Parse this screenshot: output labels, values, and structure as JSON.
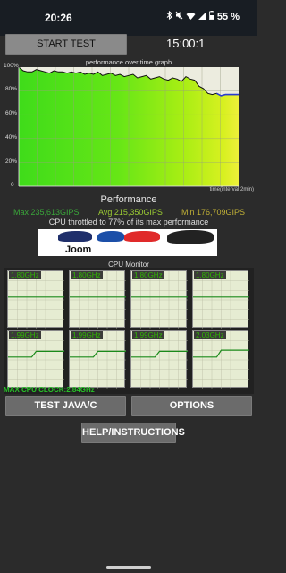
{
  "status_bar": {
    "time": "20:26",
    "battery": "55 %",
    "icons": [
      "bluetooth-icon",
      "mute-icon",
      "wifi-icon",
      "signal-icon",
      "battery-icon"
    ]
  },
  "controls": {
    "start_label": "START TEST",
    "timer": "15:00:1"
  },
  "graph": {
    "title": "performance over time graph",
    "y_labels": [
      "100%",
      "80%",
      "60%",
      "40%",
      "20%",
      "0"
    ],
    "x_note": "time(interval 2min)"
  },
  "chart_data": {
    "type": "line",
    "title": "performance over time graph",
    "xlabel": "time(interval 2min)",
    "ylabel": "",
    "ylim": [
      0,
      100
    ],
    "x": [
      0,
      1,
      2,
      3,
      4,
      5,
      6,
      7,
      8,
      9,
      10,
      11,
      12,
      13,
      14,
      15,
      16,
      17,
      18,
      19,
      20,
      21,
      22,
      23,
      24,
      25,
      26,
      27,
      28,
      29,
      30,
      31,
      32,
      33,
      34,
      35,
      36,
      37,
      38,
      39,
      40,
      41,
      42,
      43,
      44,
      45,
      46,
      47,
      48,
      49,
      50
    ],
    "values": [
      100,
      97,
      96,
      96,
      98,
      97,
      96,
      95,
      97,
      96,
      96,
      95,
      96,
      95,
      96,
      94,
      95,
      94,
      96,
      93,
      94,
      95,
      93,
      94,
      92,
      93,
      94,
      91,
      92,
      93,
      90,
      91,
      92,
      90,
      89,
      91,
      90,
      88,
      92,
      90,
      89,
      84,
      82,
      78,
      77,
      78,
      76,
      77,
      77,
      77,
      77
    ]
  },
  "performance": {
    "title": "Performance",
    "max": "Max 235,613GIPS",
    "avg": "Avg 215,350GIPS",
    "min": "Min 176,709GIPS",
    "throttle": "CPU throttled to 77% of its max performance",
    "colors": {
      "max": "#3aa63a",
      "avg": "#9ccc33",
      "min": "#c0b036"
    }
  },
  "ad": {
    "brand": "Joom"
  },
  "cpu": {
    "title": "CPU Monitor",
    "cores": [
      {
        "freq": "1.80GHz",
        "level": 0.55,
        "step": false
      },
      {
        "freq": "1.80GHz",
        "level": 0.55,
        "step": false
      },
      {
        "freq": "1.80GHz",
        "level": 0.55,
        "step": false
      },
      {
        "freq": "1.80GHz",
        "level": 0.55,
        "step": false
      },
      {
        "freq": "1.99GHz",
        "level": 0.65,
        "step": true
      },
      {
        "freq": "1.99GHz",
        "level": 0.65,
        "step": true
      },
      {
        "freq": "1.99GHz",
        "level": 0.65,
        "step": true
      },
      {
        "freq": "2.03GHz",
        "level": 0.67,
        "step": true
      }
    ],
    "max_clock": "MAX CPU CLOCK:2.84GHz"
  },
  "buttons": {
    "java": "TEST JAVA/C",
    "options": "OPTIONS",
    "help": "HELP/INSTRUCTIONS"
  }
}
